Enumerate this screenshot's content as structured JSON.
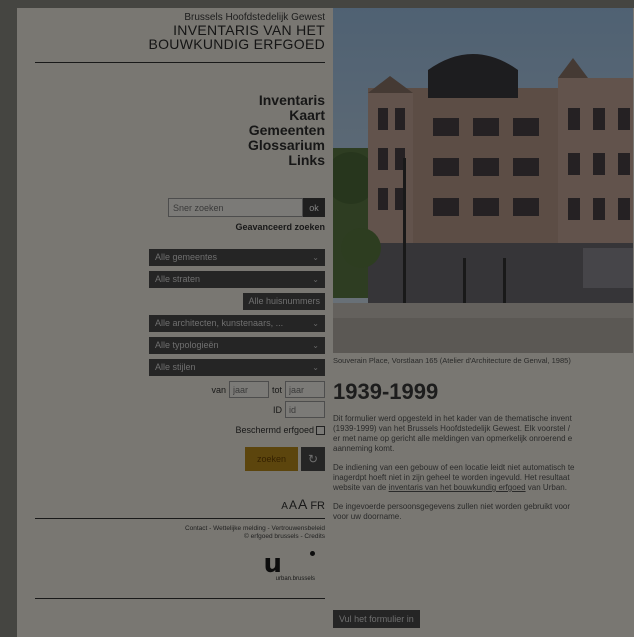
{
  "brand": {
    "region": "Brussels Hoofdstedelijk Gewest",
    "title_line1": "INVENTARIS VAN HET",
    "title_line2": "BOUWKUNDIG ERFGOED"
  },
  "nav": {
    "items": [
      "Inventaris",
      "Kaart",
      "Gemeenten",
      "Glossarium",
      "Links"
    ]
  },
  "search": {
    "placeholder": "Sner zoeken",
    "button": "ok",
    "advanced": "Geavanceerd zoeken"
  },
  "filters": {
    "selects": [
      "Alle gemeentes",
      "Alle straten",
      "Alle architecten, kunstenaars, ...",
      "Alle typologieën",
      "Alle stijlen"
    ],
    "house_numbers": "Alle huisnummers",
    "from_label": "van",
    "to_label": "tot",
    "year_placeholder": "jaar",
    "id_label": "ID",
    "id_placeholder": "id",
    "protected_label": "Beschermd erfgoed",
    "search_button": "zoeken",
    "reset_icon": "↻"
  },
  "font_controls": {
    "small": "A",
    "medium": "A",
    "large": "A",
    "language": "FR"
  },
  "footer": {
    "links_line1": "Contact - Wettelijke melding - Vertrouwensbeleid",
    "links_line2": "© erfgoed brussels - Credits",
    "logo_letter": "u",
    "logo_text": "urban.brussels"
  },
  "main": {
    "caption": "Souverain Place, Vorstlaan 165 (Atelier d'Architecture de Genval, 1985)",
    "heading": "1939-1999",
    "para1_line1": "Dit formulier werd opgesteld in het kader van de thematische invent",
    "para1_line2": "(1939-1999) van het Brussels Hoofdstedelijk Gewest. Elk voorstel /",
    "para1_line3": "er met name op gericht alle meldingen van opmerkelijk onroerend e",
    "para1_line4": "aanneming komt.",
    "para2_line1": "De indiening van een gebouw of een locatie leidt niet automatisch te",
    "para2_line2": "inagerdpt hoeft niet in zijn geheel te worden ingevuld. Het resultaat",
    "para2_line3_a": "website van de ",
    "para2_line3_link": "inventaris van het bouwkundig erfgoed",
    "para2_line3_b": " van Urban.",
    "para3_line1": "De ingevoerde persoonsgegevens zullen niet worden gebruikt voor",
    "para3_line2": "voor uw doorname.",
    "fill_button": "Vul het formulier in"
  }
}
